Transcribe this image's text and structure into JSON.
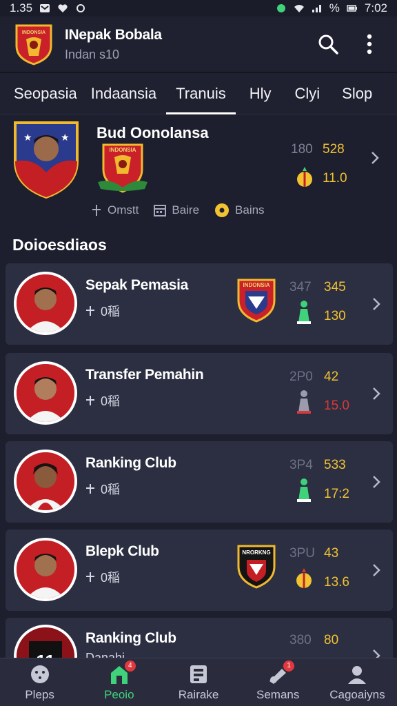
{
  "status_bar": {
    "time_left": "1.35",
    "battery_percent": "%",
    "time_right": "7:02"
  },
  "header": {
    "title": "INepak Bobala",
    "subtitle": "Indan s10",
    "logo_text": "INDONSIA"
  },
  "tabs": [
    {
      "label": "Seopasia"
    },
    {
      "label": "Indaansia"
    },
    {
      "label": "Tranuis",
      "active": true
    },
    {
      "label": "Hly"
    },
    {
      "label": "Clyi"
    },
    {
      "label": "Slop"
    }
  ],
  "featured": {
    "name": "Bud Oonolansa",
    "badge_text": "INDONSIA",
    "stat_a": "180",
    "stat_b": "528",
    "stat_c": "11.0",
    "meta": [
      "Omstt",
      "Baire",
      "Bains"
    ]
  },
  "section_title": "Doioesdiaos",
  "cards": [
    {
      "name": "Sepak Pemasia",
      "sub": "0稲",
      "stat_a": "347",
      "stat_b": "345",
      "stat_c": "130",
      "stat_c_color": "#f1c232",
      "crest_text": "INDONSIA"
    },
    {
      "name": "Transfer Pemahin",
      "sub": "0稲",
      "stat_a": "2P0",
      "stat_b": "42",
      "stat_c": "15.0",
      "stat_c_color": "#d63a3a"
    },
    {
      "name": "Ranking Club",
      "sub": "0稲",
      "stat_a": "3P4",
      "stat_b": "533",
      "stat_c": "17:2",
      "stat_c_color": "#f1c232"
    },
    {
      "name": "Blepk Club",
      "sub": "0稲",
      "stat_a": "3PU",
      "stat_b": "43",
      "stat_c": "13.6",
      "stat_c_color": "#f1c232",
      "crest_text": "NRORKNG"
    },
    {
      "name": "Ranking Club",
      "sub": "Danahi",
      "stat_a": "380",
      "stat_b": "80",
      "stat_c": "",
      "stat_c_color": "#f1c232"
    }
  ],
  "bottom_nav": [
    {
      "label": "Pleps"
    },
    {
      "label": "Peoio",
      "active": true,
      "badge": "4"
    },
    {
      "label": "Rairake"
    },
    {
      "label": "Semans",
      "badge": "1"
    },
    {
      "label": "Cagoaiyns"
    }
  ],
  "colors": {
    "background": "#1d1f2e",
    "card": "#2c2f42",
    "accent_green": "#3fd27a",
    "accent_gold": "#f1c232",
    "accent_red": "#d63a3a"
  }
}
